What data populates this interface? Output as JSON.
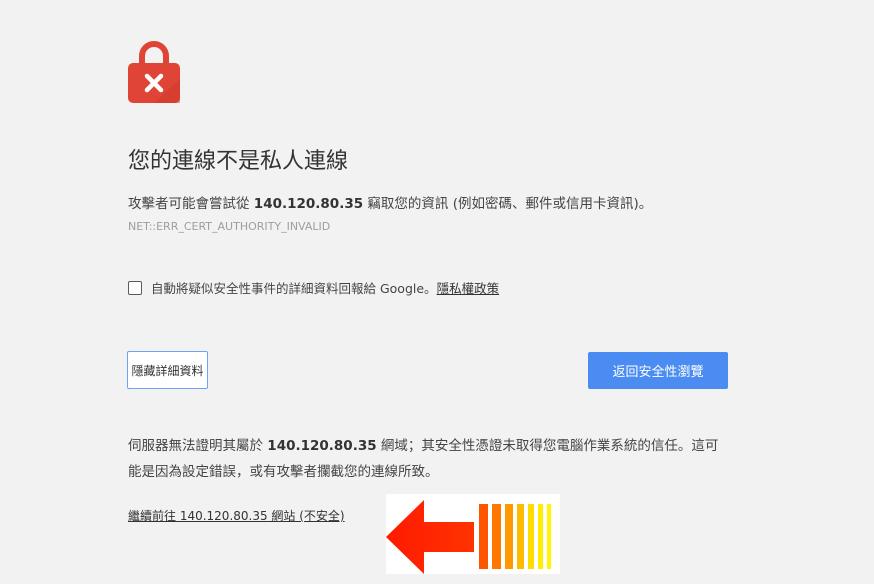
{
  "lock_icon": "lock-error-icon",
  "colors": {
    "lock_red": "#e04436",
    "primary_button": "#4a8cf1",
    "arrow_red": "#ff1a00"
  },
  "heading": "您的連線不是私人連線",
  "description": {
    "prefix": "攻擊者可能會嘗試從 ",
    "host": "140.120.80.35",
    "suffix": " 竊取您的資訊 (例如密碼、郵件或信用卡資訊)。"
  },
  "error_code": "NET::ERR_CERT_AUTHORITY_INVALID",
  "report": {
    "checked": false,
    "label": "自動將疑似安全性事件的詳細資料回報給 Google。",
    "privacy_link": "隱私權政策"
  },
  "buttons": {
    "details": "隱藏詳細資料",
    "back": "返回安全性瀏覽"
  },
  "details_text": {
    "prefix": "伺服器無法證明其屬於 ",
    "host": "140.120.80.35",
    "suffix": " 網域；其安全性憑證未取得您電腦作業系統的信任。這可能是因為設定錯誤，或有攻擊者攔截您的連線所致。"
  },
  "proceed_link": "繼續前往 140.120.80.35 網站 (不安全)",
  "annotation_icon": "red-arrow-icon"
}
